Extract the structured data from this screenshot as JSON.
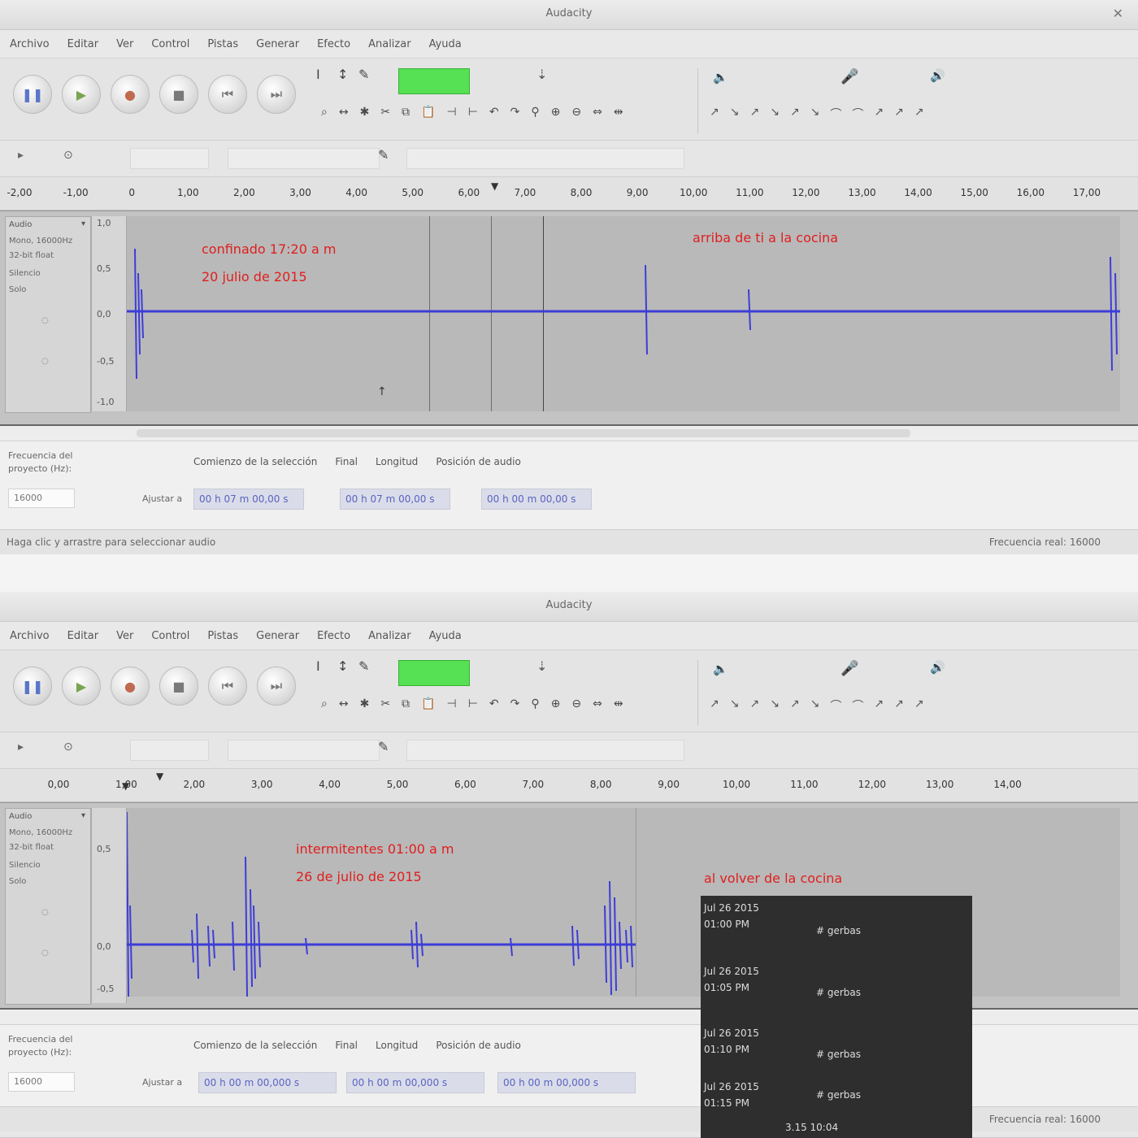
{
  "windows": [
    {
      "title": "Audacity",
      "menu": [
        "Archivo",
        "Editar",
        "Ver",
        "Control",
        "Pistas",
        "Generar",
        "Efecto",
        "Analizar",
        "Ayuda"
      ],
      "transport": [
        {
          "name": "pause",
          "glyph": "❚❚"
        },
        {
          "name": "play",
          "glyph": "▶"
        },
        {
          "name": "record",
          "glyph": "●"
        },
        {
          "name": "stop",
          "glyph": "■"
        },
        {
          "name": "skip-start",
          "glyph": "⏮"
        },
        {
          "name": "skip-end",
          "glyph": "⏭"
        }
      ],
      "ruler_ticks": [
        "-2,00",
        "-1,00",
        "0",
        "1,00",
        "2,00",
        "3,00",
        "4,00",
        "5,00",
        "6,00",
        "7,00",
        "8,00",
        "9,00",
        "10,00",
        "11,00",
        "12,00",
        "13,00",
        "14,00",
        "15,00",
        "16,00",
        "17,00"
      ],
      "track": {
        "name": "Audio",
        "info": [
          "Mono, 16000Hz",
          "32-bit float",
          "Silencio",
          "Solo"
        ],
        "scale": [
          "1,0",
          "0,5",
          "0,0",
          "-0,5",
          "-1,0"
        ]
      },
      "notes": [
        {
          "lines": [
            "confinado 17:20 a m",
            "20 julio de 2015"
          ]
        },
        {
          "lines": [
            "arriba de ti a la cocina"
          ]
        }
      ],
      "selection": {
        "rate_label": "Frecuencia del proyecto (Hz):",
        "rate_value": "16000",
        "snap": "Ajustar a",
        "labels": [
          "Comienzo de la selección",
          "Final",
          "Longitud",
          "Posición de audio"
        ],
        "times": [
          "00 h 07 m 00,00 s",
          "00 h 07 m 00,00 s",
          "00 h 00 m 00,00 s"
        ]
      },
      "status": {
        "left": "Haga clic y arrastre para seleccionar audio",
        "right": "Frecuencia real: 16000"
      }
    },
    {
      "title": "Audacity",
      "menu": [
        "Archivo",
        "Editar",
        "Ver",
        "Control",
        "Pistas",
        "Generar",
        "Efecto",
        "Analizar",
        "Ayuda"
      ],
      "transport": [
        {
          "name": "pause",
          "glyph": "❚❚"
        },
        {
          "name": "play",
          "glyph": "▶"
        },
        {
          "name": "record",
          "glyph": "●"
        },
        {
          "name": "stop",
          "glyph": "■"
        },
        {
          "name": "skip-start",
          "glyph": "⏮"
        },
        {
          "name": "skip-end",
          "glyph": "⏭"
        }
      ],
      "ruler_ticks": [
        "0,00",
        "1,00",
        "2,00",
        "3,00",
        "4,00",
        "5,00",
        "6,00",
        "7,00",
        "8,00",
        "9,00",
        "10,00",
        "11,00",
        "12,00",
        "13,00",
        "14,00"
      ],
      "track": {
        "name": "Audio",
        "info": [
          "Mono, 16000Hz",
          "32-bit float",
          "Silencio",
          "Solo"
        ],
        "scale": [
          "0,5",
          "0,0",
          "-0,5"
        ]
      },
      "notes": [
        {
          "lines": [
            "intermitentes 01:00 a m",
            "26 de julio de 2015"
          ]
        },
        {
          "lines": [
            "al volver de la cocina"
          ]
        }
      ],
      "selection": {
        "rate_label": "Frecuencia del proyecto (Hz):",
        "rate_value": "16000",
        "snap": "Ajustar a",
        "labels": [
          "Comienzo de la selección",
          "Final",
          "Longitud",
          "Posición de audio"
        ],
        "times": [
          "00 h 00 m 00,000 s",
          "00 h 00 m 00,000 s",
          "00 h 00 m 00,000 s"
        ]
      },
      "status": {
        "left": "",
        "right": "Frecuencia real: 16000"
      }
    }
  ],
  "terminal": {
    "rows": [
      {
        "date": "Jul 26 2015",
        "time": "01:00 PM",
        "user": "# gerbas"
      },
      {
        "date": "Jul 26 2015",
        "time": "01:05 PM",
        "user": "# gerbas"
      },
      {
        "date": "Jul 26 2015",
        "time": "01:10 PM",
        "user": "# gerbas"
      },
      {
        "date": "Jul 26 2015",
        "time": "01:15 PM",
        "user": "# gerbas"
      }
    ],
    "footer": "3.15 10:04"
  },
  "colors": {
    "waveform": "#3d3dd8",
    "note": "#e11e1e",
    "meter": "#56e053"
  }
}
